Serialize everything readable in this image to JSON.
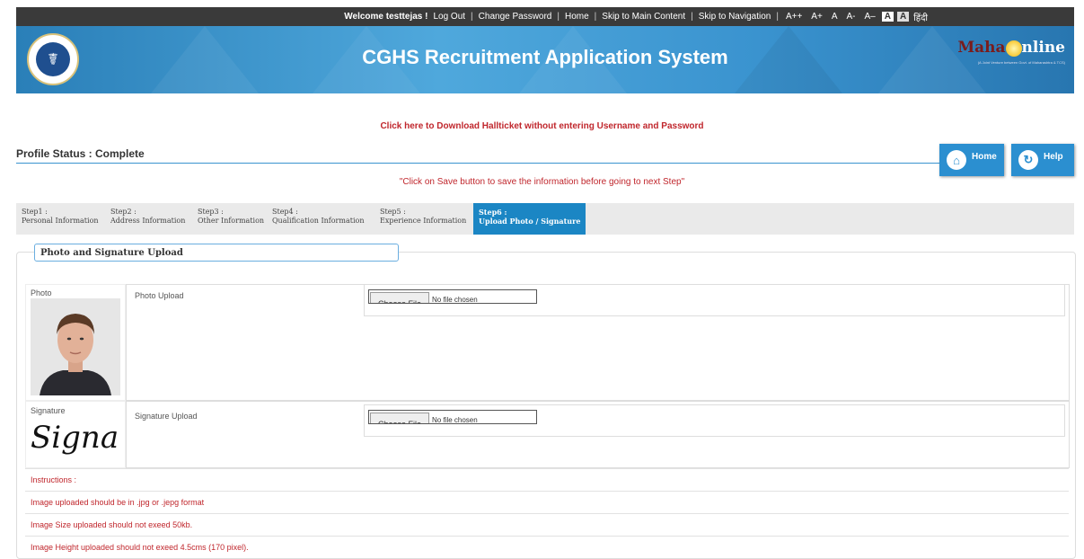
{
  "topbar": {
    "welcome": "Welcome testtejas !",
    "logout": "Log Out",
    "change_password": "Change Password",
    "home": "Home",
    "skip_main": "Skip to Main Content",
    "skip_nav": "Skip to Navigation",
    "font_sizes": [
      "A++",
      "A+",
      "A",
      "A-",
      "A–"
    ],
    "contrast": [
      "A",
      "A"
    ],
    "hindi": "हिंदी",
    "sep": "|"
  },
  "header": {
    "title": "CGHS Recruitment Application System",
    "logo_text": "Maha",
    "logo_text2": "nline",
    "logo_tagline": "(A Joint Venture between Govt. of Maharashtra & TCS)"
  },
  "download_link": "Click here to Download Hallticket without entering Username and Password",
  "profile_status": "Profile Status : Complete",
  "buttons": {
    "home": "Home",
    "help": "Help"
  },
  "save_note": "\"Click on Save button to save the information before going to next Step\"",
  "steps": [
    {
      "num": "Step1 :",
      "label": "Personal Information"
    },
    {
      "num": "Step2 :",
      "label": "Address Information"
    },
    {
      "num": "Step3 :",
      "label": "Other Information"
    },
    {
      "num": "Step4 :",
      "label": "Qualification Information"
    },
    {
      "num": "Step5 :",
      "label": "Experience Information"
    },
    {
      "num": "Step6 :",
      "label": "Upload Photo / Signature"
    }
  ],
  "panel_title": "Photo and Signature Upload",
  "photo": {
    "label": "Photo",
    "upload_label": "Photo Upload",
    "choose": "Choose File",
    "none": "No file chosen"
  },
  "signature": {
    "label": "Signature",
    "upload_label": "Signature Upload",
    "choose": "Choose File",
    "none": "No file chosen",
    "sample": "Signa"
  },
  "instructions": [
    "Instructions :",
    "Image uploaded should be in .jpg or .jepg format",
    "Image Size uploaded should not exeed 50kb.",
    "Image Height uploaded should not exeed 4.5cms (170 pixel)."
  ],
  "colors": {
    "accent": "#2b8fd0",
    "alert": "#c0262c",
    "topbar": "#3a3a3a"
  }
}
